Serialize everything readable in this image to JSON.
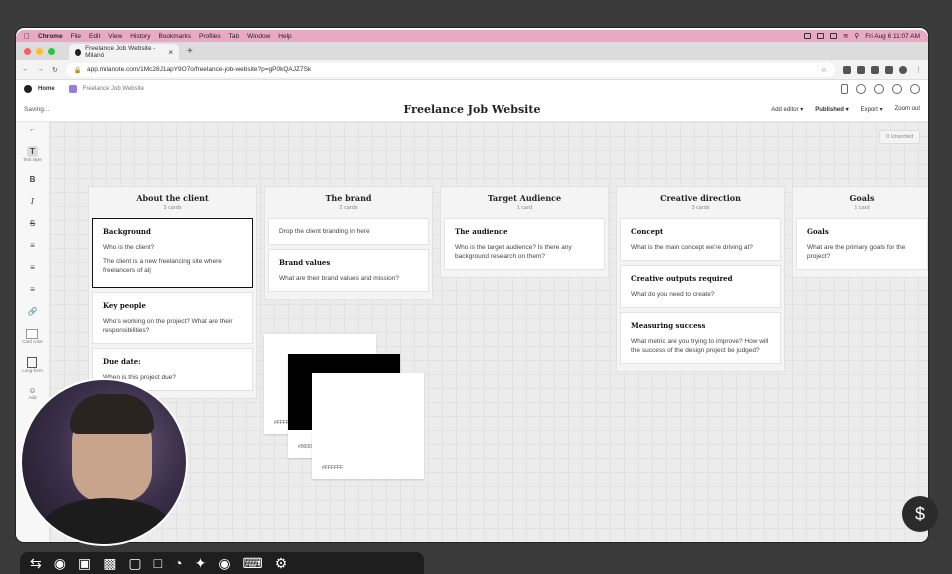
{
  "menubar": {
    "app": "Chrome",
    "items": [
      "File",
      "Edit",
      "View",
      "History",
      "Bookmarks",
      "Profiles",
      "Tab",
      "Window",
      "Help"
    ],
    "datetime": "Fri Aug 6  11:07 AM"
  },
  "browser": {
    "tab_title": "Freelance Job Website - Milanó",
    "url": "app.milanote.com/1Mc28J1apY9O7o/freelance-job-website?p=gP0kQAJZ7Sk"
  },
  "app_header": {
    "home_label": "Home",
    "breadcrumb": "Freelance Job Website",
    "status": "Saving...",
    "board_title": "Freelance Job Website",
    "actions": [
      "Add editor ▾",
      "Published ▾",
      "Export ▾",
      "Zoom out"
    ]
  },
  "toolbar": {
    "text_style": "Text style",
    "bold": "B",
    "italic": "I",
    "strike": "S",
    "card_label": "Card color",
    "longform_label": "Long-form",
    "add_label": "Add",
    "trash_label": "Trash"
  },
  "unsorted": "0 Unsorted",
  "columns": [
    {
      "title": "About the client",
      "count": "3 cards",
      "cards": [
        {
          "title": "Background",
          "lines": [
            "Who is the client?",
            "The client is a new freelancing site where freelancers of al|"
          ]
        },
        {
          "title": "Key people",
          "lines": [
            "Who's working on the project? What are their responsibilities?"
          ]
        },
        {
          "title": "Due date:",
          "lines": [
            "When is this project due?"
          ]
        }
      ]
    },
    {
      "title": "The brand",
      "count": "2 cards",
      "cards": [
        {
          "title": "",
          "lines": [
            "Drop the client branding in here"
          ]
        },
        {
          "title": "Brand values",
          "lines": [
            "What are their brand values and mission?"
          ]
        }
      ]
    },
    {
      "title": "Target Audience",
      "count": "1 card",
      "cards": [
        {
          "title": "The audience",
          "lines": [
            "Who is the target audience? Is there any background research on them?"
          ]
        }
      ]
    },
    {
      "title": "Creative direction",
      "count": "3 cards",
      "cards": [
        {
          "title": "Concept",
          "lines": [
            "What is the main concept we're driving at?"
          ]
        },
        {
          "title": "Creative outputs required",
          "lines": [
            "What do you need to create?"
          ]
        },
        {
          "title": "Measuring success",
          "lines": [
            "What metric are you trying to improve? How will the success of the design project be judged?"
          ]
        }
      ]
    },
    {
      "title": "Goals",
      "count": "1 card",
      "cards": [
        {
          "title": "Goals",
          "lines": [
            "What are the primary goals for the project?"
          ]
        }
      ]
    }
  ],
  "swatches": [
    {
      "hex": "#FFFFFF",
      "color": "#ffffff"
    },
    {
      "hex": "#000000",
      "color": "#000000"
    },
    {
      "hex": "#FFFFFF",
      "color": "#ffffff"
    }
  ]
}
